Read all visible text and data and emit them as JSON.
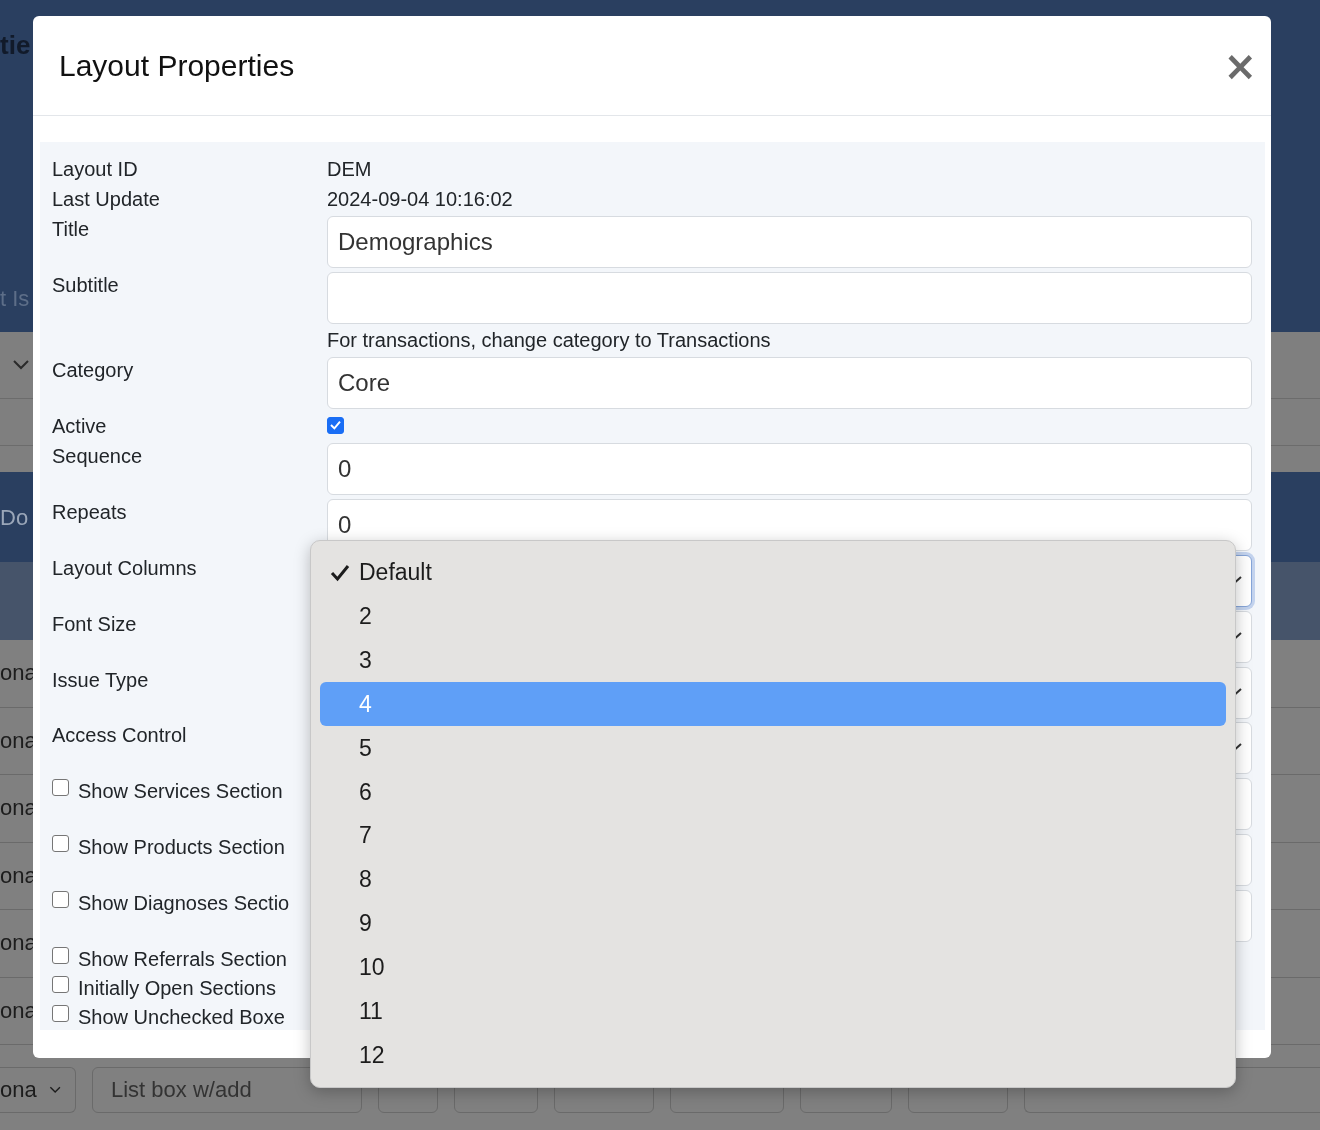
{
  "backdrop": {
    "heading_fragment": "tie",
    "subheading_fragment": "t Is",
    "button_fragment": "Do",
    "row_labels": [
      "ona",
      "ona",
      "ona",
      "ona",
      "ona",
      "ona"
    ],
    "bottom_row": {
      "select": "ona",
      "field": "List box w/add"
    }
  },
  "modal": {
    "title": "Layout Properties",
    "close": "×",
    "rows": [
      {
        "kind": "text",
        "label": "Layout ID",
        "value": "DEM"
      },
      {
        "kind": "text",
        "label": "Last Update",
        "value": "2024-09-04 10:16:02"
      },
      {
        "kind": "input",
        "label": "Title",
        "value": "Demographics"
      },
      {
        "kind": "input",
        "label": "Subtitle"
      },
      {
        "kind": "hint",
        "value": "For transactions, change category to Transactions"
      },
      {
        "kind": "input",
        "label": "Category",
        "value": "Core"
      },
      {
        "kind": "checkbox",
        "label": "Active",
        "checked": true
      },
      {
        "kind": "input",
        "label": "Sequence",
        "value": "0"
      },
      {
        "kind": "input",
        "label": "Repeats",
        "value": "0"
      },
      {
        "kind": "select",
        "label": "Layout Columns",
        "focused": true
      },
      {
        "kind": "select",
        "label": "Font Size",
        "focused": false
      },
      {
        "kind": "select",
        "label": "Issue Type",
        "focused": false
      },
      {
        "kind": "select",
        "label": "Access Control",
        "focused": false
      },
      {
        "kind": "check-field",
        "label": "Show Services Section",
        "checked": false
      },
      {
        "kind": "check-field",
        "label": "Show Products Section",
        "checked": false
      },
      {
        "kind": "check-field",
        "label": "Show Diagnoses Sectio",
        "checked": false
      },
      {
        "kind": "check",
        "label": "Show Referrals Section",
        "checked": false
      },
      {
        "kind": "check",
        "label": "Initially Open Sections",
        "checked": false
      },
      {
        "kind": "check",
        "label": "Show Unchecked Boxe",
        "checked": false
      }
    ]
  },
  "dropdown": {
    "options": [
      {
        "label": "Default",
        "selected": true,
        "highlighted": false
      },
      {
        "label": "2",
        "selected": false,
        "highlighted": false
      },
      {
        "label": "3",
        "selected": false,
        "highlighted": false
      },
      {
        "label": "4",
        "selected": false,
        "highlighted": true
      },
      {
        "label": "5",
        "selected": false,
        "highlighted": false
      },
      {
        "label": "6",
        "selected": false,
        "highlighted": false
      },
      {
        "label": "7",
        "selected": false,
        "highlighted": false
      },
      {
        "label": "8",
        "selected": false,
        "highlighted": false
      },
      {
        "label": "9",
        "selected": false,
        "highlighted": false
      },
      {
        "label": "10",
        "selected": false,
        "highlighted": false
      },
      {
        "label": "11",
        "selected": false,
        "highlighted": false
      },
      {
        "label": "12",
        "selected": false,
        "highlighted": false
      }
    ]
  }
}
